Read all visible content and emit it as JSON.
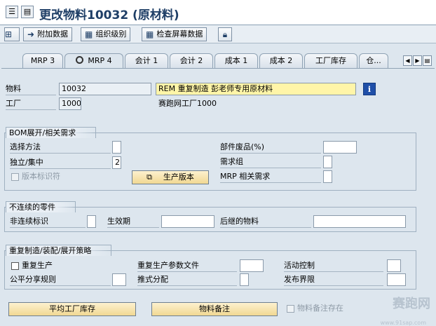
{
  "window": {
    "title": "更改物料10032 (原材料)"
  },
  "toolbar": {
    "additional_data": "附加数据",
    "org_levels": "组织级别",
    "check_screen_data": "检查屏幕数据"
  },
  "tabs": [
    {
      "label": "MRP 3"
    },
    {
      "label": "MRP 4"
    },
    {
      "label": "会计 1"
    },
    {
      "label": "会计 2"
    },
    {
      "label": "成本 1"
    },
    {
      "label": "成本 2"
    },
    {
      "label": "工厂库存"
    },
    {
      "label": "仓..."
    }
  ],
  "header": {
    "material_label": "物料",
    "material_value": "10032",
    "material_desc": "REM 重复制造 彭老师专用原材料",
    "plant_label": "工厂",
    "plant_value": "1000",
    "plant_desc": "赛跑网工厂1000"
  },
  "bom": {
    "title": "BOM展开/相关需求",
    "selection_method": "选择方法",
    "selection_method_value": "",
    "individual_collective": "独立/集中",
    "individual_collective_value": "2",
    "version_indicator": "版本标识符",
    "production_version_button": "生产版本",
    "component_scrap": "部件废品(%)",
    "component_scrap_value": "",
    "req_group": "需求组",
    "mrp_dep_req": "MRP 相关需求"
  },
  "discontinued": {
    "title": "不连续的零件",
    "discontinuation_ind": "非连续标识",
    "effective_out": "生效期",
    "follow_up_material": "后继的物料"
  },
  "rem": {
    "title": "重复制造/装配/展开策略",
    "repetitive_mfg": "重复生产",
    "rem_profile": "重复生产参数文件",
    "action_control": "活动控制",
    "fair_share_rule": "公平分享规则",
    "push_distribution": "推式分配",
    "deployment_horizon": "发布界限"
  },
  "bottom": {
    "avg_plant_stock": "平均工厂库存",
    "material_memo": "物料备注",
    "material_memo_exists": "物料备注存在"
  },
  "watermark": {
    "text": "赛跑网",
    "url": "www.91sap.com"
  },
  "colors": {
    "yellow_field": "#fff5a8",
    "panel_bg": "#dde6ee",
    "title_blue": "#1e3e66"
  }
}
